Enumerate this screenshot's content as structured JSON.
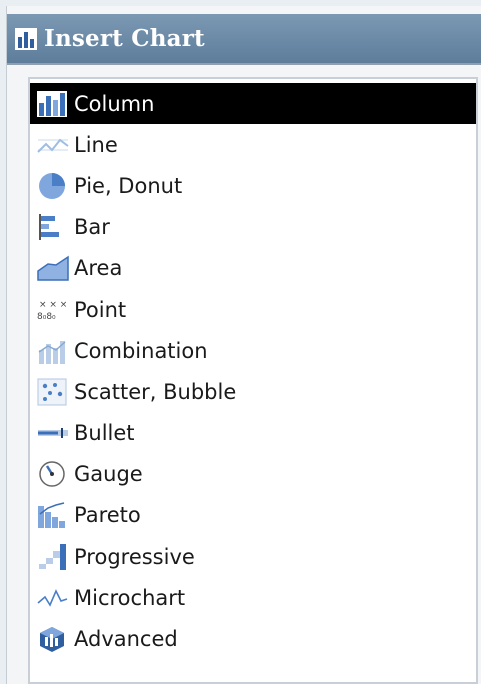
{
  "dialog": {
    "title": "Insert Chart",
    "title_icon": "bar-chart-icon"
  },
  "chart_types": [
    {
      "label": "Column",
      "icon": "column-chart-icon",
      "selected": true
    },
    {
      "label": "Line",
      "icon": "line-chart-icon",
      "selected": false
    },
    {
      "label": "Pie, Donut",
      "icon": "pie-chart-icon",
      "selected": false
    },
    {
      "label": "Bar",
      "icon": "bar-chart-icon",
      "selected": false
    },
    {
      "label": "Area",
      "icon": "area-chart-icon",
      "selected": false
    },
    {
      "label": "Point",
      "icon": "point-chart-icon",
      "selected": false
    },
    {
      "label": "Combination",
      "icon": "combination-chart-icon",
      "selected": false
    },
    {
      "label": "Scatter, Bubble",
      "icon": "scatter-chart-icon",
      "selected": false
    },
    {
      "label": "Bullet",
      "icon": "bullet-chart-icon",
      "selected": false
    },
    {
      "label": "Gauge",
      "icon": "gauge-icon",
      "selected": false
    },
    {
      "label": "Pareto",
      "icon": "pareto-chart-icon",
      "selected": false
    },
    {
      "label": "Progressive",
      "icon": "progressive-chart-icon",
      "selected": false
    },
    {
      "label": "Microchart",
      "icon": "microchart-icon",
      "selected": false
    },
    {
      "label": "Advanced",
      "icon": "advanced-chart-icon",
      "selected": false
    }
  ],
  "colors": {
    "title_bar": "#6a8aa8",
    "selection": "#000000",
    "icon_blue": "#4a7fc8"
  }
}
